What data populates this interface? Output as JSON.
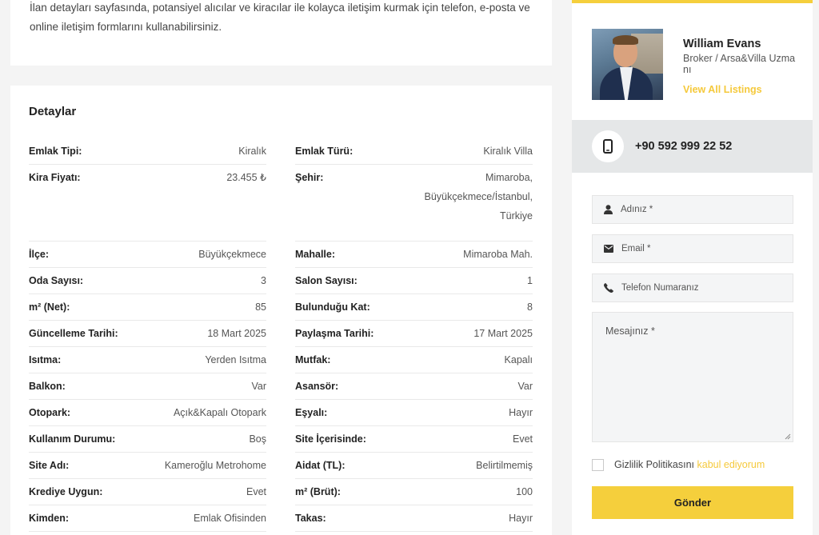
{
  "intro": {
    "text": "İlan detayları sayfasında, potansiyel alıcılar ve kiracılar ile kolayca iletişim kurmak için telefon, e-posta ve online iletişim formlarını kullanabilirsiniz."
  },
  "details": {
    "title": "Detaylar",
    "left": [
      {
        "label": "Emlak Tipi:",
        "value": "Kiralık"
      },
      {
        "label": "Kira Fiyatı:",
        "value": "23.455 ₺"
      },
      {
        "label": "İlçe:",
        "value": "Büyükçekmece"
      },
      {
        "label": "Oda Sayısı:",
        "value": "3"
      },
      {
        "label": "m² (Net):",
        "value": "85"
      },
      {
        "label": "Güncelleme Tarihi:",
        "value": "18 Mart 2025"
      },
      {
        "label": "Isıtma:",
        "value": "Yerden Isıtma"
      },
      {
        "label": "Balkon:",
        "value": "Var"
      },
      {
        "label": "Otopark:",
        "value": "Açık&Kapalı Otopark"
      },
      {
        "label": "Kullanım Durumu:",
        "value": "Boş"
      },
      {
        "label": "Site Adı:",
        "value": "Kameroğlu Metrohome"
      },
      {
        "label": "Krediye Uygun:",
        "value": "Evet"
      },
      {
        "label": "Kimden:",
        "value": "Emlak Ofisinden"
      }
    ],
    "right": [
      {
        "label": "Emlak Türü:",
        "value": "Kiralık Villa"
      },
      {
        "label": "Şehir:",
        "value": "Mimaroba, Büyükçekmece/İstanbul, Türkiye"
      },
      {
        "label": "Mahalle:",
        "value": "Mimaroba Mah."
      },
      {
        "label": "Salon Sayısı:",
        "value": "1"
      },
      {
        "label": "Bulunduğu Kat:",
        "value": "8"
      },
      {
        "label": "Paylaşma Tarihi:",
        "value": "17 Mart 2025"
      },
      {
        "label": "Mutfak:",
        "value": "Kapalı"
      },
      {
        "label": "Asansör:",
        "value": "Var"
      },
      {
        "label": "Eşyalı:",
        "value": "Hayır"
      },
      {
        "label": "Site İçerisinde:",
        "value": "Evet"
      },
      {
        "label": "Aidat (TL):",
        "value": "Belirtilmemiş"
      },
      {
        "label": "m² (Brüt):",
        "value": "100"
      },
      {
        "label": "Takas:",
        "value": "Hayır"
      }
    ]
  },
  "agent": {
    "name": "William Evans",
    "role": "Broker / Arsa&Villa Uzmanı",
    "link_label": "View All Listings",
    "phone": "+90 592 999 22 52"
  },
  "form": {
    "name_placeholder": "Adınız *",
    "email_placeholder": "Email *",
    "phone_placeholder": "Telefon Numaranız",
    "message_placeholder": "Mesajınız *",
    "consent_text": "Gizlilik Politikasını",
    "consent_link": "kabul ediyorum",
    "submit_label": "Gönder"
  },
  "colors": {
    "accent": "#f5cf3c",
    "link": "#f5c93b",
    "phone_bar": "#e5e7e8"
  },
  "icons": {
    "phone": "mobile-phone-icon",
    "user": "user-icon",
    "email": "envelope-icon",
    "telephone": "telephone-icon"
  }
}
